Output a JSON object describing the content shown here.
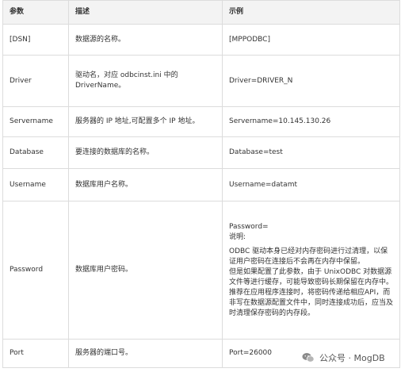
{
  "header": {
    "col_param": "参数",
    "col_desc": "描述",
    "col_example": "示例"
  },
  "rows": [
    {
      "param": "[DSN]",
      "desc": "数据源的名称。",
      "example": "[MPPODBC]"
    },
    {
      "param": "Driver",
      "desc": "驱动名，对应 odbcinst.ini 中的 DriverName。",
      "example": "Driver=DRIVER_N"
    },
    {
      "param": "Servername",
      "desc": "服务器的 IP 地址,可配置多个 IP 地址。",
      "example": "Servername=10.145.130.26"
    },
    {
      "param": "Database",
      "desc": "要连接的数据库的名称。",
      "example": "Database=test"
    },
    {
      "param": "Username",
      "desc": "数据库用户名称。",
      "example": "Username=datamt"
    },
    {
      "param": "Password",
      "desc": "数据库用户密码。",
      "example_lines": [
        "Password=",
        "说明:",
        "ODBC 驱动本身已经对内存密码进行过清理，以保证用户密码在连接后不会再在内存中保留。",
        "但是如果配置了此参数，由于 UnixODBC 对数据源文件等进行缓存，可能导致密码长期保留在内存中。",
        "推荐在应用程序连接时，将密码传递给相应API，而非写在数据源配置文件中，同时连接成功后，应当及时清理保存密码的内存段。"
      ]
    },
    {
      "param": "Port",
      "desc": "服务器的端口号。",
      "example": "Port=26000"
    }
  ],
  "watermark": {
    "text": "公众号 · MogDB",
    "icon": "wechat-icon"
  }
}
